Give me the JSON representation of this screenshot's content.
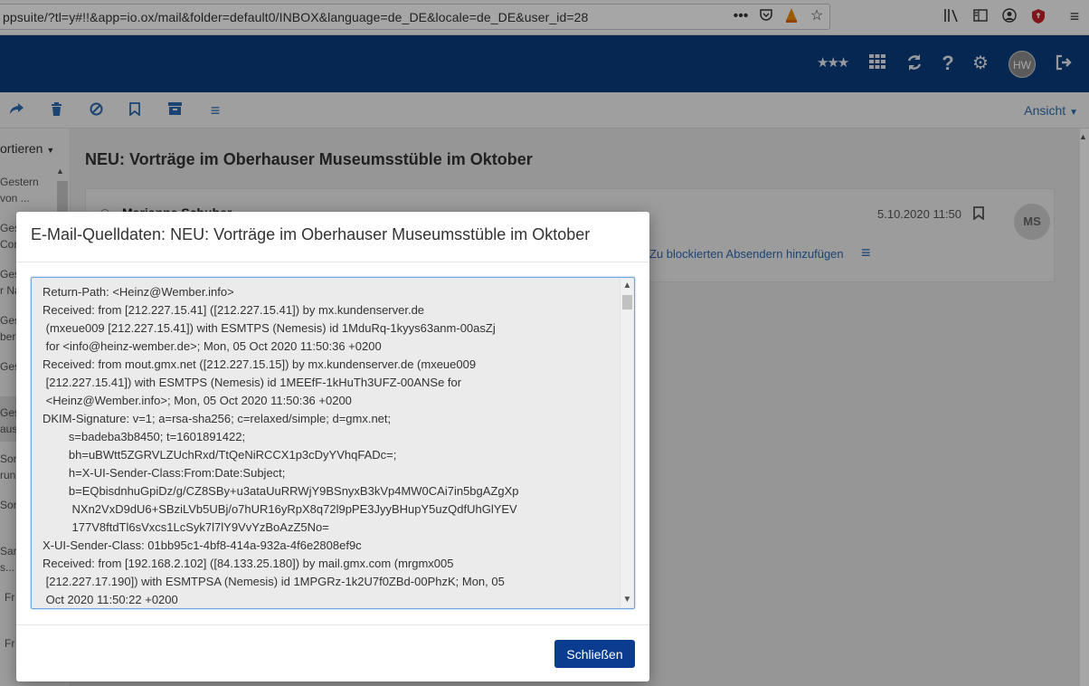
{
  "browser": {
    "url": "ppsuite/?tl=y#!!&app=io.ox/mail&folder=default0/INBOX&language=de_DE&locale=de_DE&user_id=28",
    "icons": [
      "more-icon",
      "pocket-icon",
      "vlc-icon",
      "star-icon",
      "library-icon",
      "reader-icon",
      "account-icon",
      "shield-icon",
      "menu-icon"
    ]
  },
  "header": {
    "avatar_initials": "HW",
    "icons": [
      "stars-icon",
      "apps-grid-icon",
      "refresh-icon",
      "help-icon",
      "settings-icon",
      "logout-icon"
    ]
  },
  "toolbar": {
    "view_label": "Ansicht",
    "icons": [
      "forward-icon",
      "delete-icon",
      "spam-icon",
      "bookmark-icon",
      "archive-icon",
      "more-actions-icon"
    ]
  },
  "list": {
    "sort_label": "ortieren",
    "items": [
      "Gestern",
      "von ...",
      "Ges",
      "Com",
      "Ges",
      "r Na",
      "Ges",
      "ber",
      "Ges",
      "Ges",
      "aus",
      "Son",
      "run",
      "Son",
      "Sam",
      "s...",
      "Fr",
      "Fr"
    ]
  },
  "mail": {
    "subject": "NEU: Vorträge im Oberhauser Museumsstüble im Oktober",
    "sender": "Marianne Schuber",
    "date": "5.10.2020 11:50",
    "avatar_initials": "MS",
    "block_link": "Zu blockierten Absendern hinzufügen"
  },
  "modal": {
    "title": "E-Mail-Quelldaten: NEU: Vorträge im Oberhauser Museumsstüble im Oktober",
    "source_lines": [
      "Return-Path: <Heinz@Wember.info>",
      "Received: from [212.227.15.41] ([212.227.15.41]) by mx.kundenserver.de",
      " (mxeue009 [212.227.15.41]) with ESMTPS (Nemesis) id 1MduRq-1kyys63anm-00asZj",
      " for <info@heinz-wember.de>; Mon, 05 Oct 2020 11:50:36 +0200",
      "Received: from mout.gmx.net ([212.227.15.15]) by mx.kundenserver.de (mxeue009",
      " [212.227.15.41]) with ESMTPS (Nemesis) id 1MEEfF-1kHuTh3UFZ-00ANSe for",
      " <Heinz@Wember.info>; Mon, 05 Oct 2020 11:50:36 +0200",
      "DKIM-Signature: v=1; a=rsa-sha256; c=relaxed/simple; d=gmx.net;",
      "        s=badeba3b8450; t=1601891422;",
      "        bh=uBWtt5ZGRVLZUchRxd/TtQeNiRCCX1p3cDyYVhqFADc=;",
      "        h=X-UI-Sender-Class:From:Date:Subject;",
      "        b=EQbisdnhuGpiDz/g/CZ8SBy+u3ataUuRRWjY9BSnyxB3kVp4MW0CAi7in5bgAZgXp",
      "         NXn2VxD9dU6+SBziLVb5UBj/o7hUR16yRpX8q72l9pPE3JyyBHupY5uzQdfUhGlYEV",
      "         177V8ftdTl6sVxcs1LcSyk7l7lY9VvYzBoAzZ5No=",
      "X-UI-Sender-Class: 01bb95c1-4bf8-414a-932a-4f6e2808ef9c",
      "Received: from [192.168.2.102] ([84.133.25.180]) by mail.gmx.com (mrgmx005",
      " [212.227.17.190]) with ESMTPSA (Nemesis) id 1MPGRz-1k2U7f0ZBd-00PhzK; Mon, 05",
      " Oct 2020 11:50:22 +0200"
    ],
    "close_label": "Schließen"
  },
  "colors": {
    "header_bg": "#0a3c7d",
    "accent": "#2c6ab3",
    "button": "#0a3c8f"
  }
}
